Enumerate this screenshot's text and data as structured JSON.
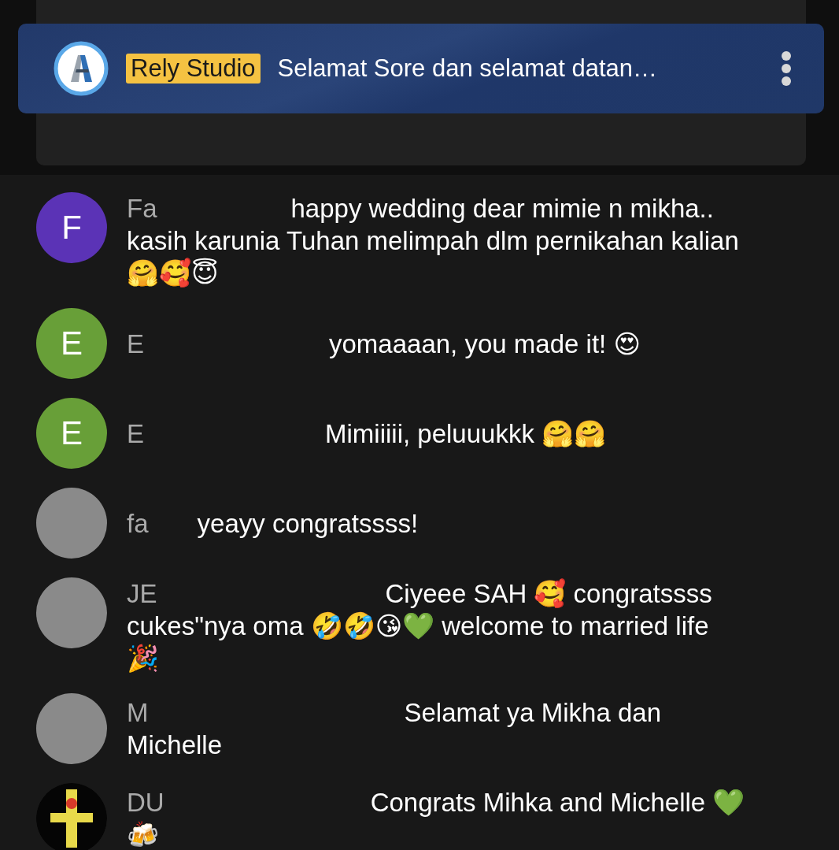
{
  "pinned_message": {
    "author": "Rely Studio",
    "message": "Selamat Sore dan selamat datan…"
  },
  "messages": [
    {
      "avatar": {
        "kind": "letter",
        "letter": "F",
        "color": "#5b33b6"
      },
      "author": "Fa",
      "message_lines": [
        "happy wedding dear mimie n mikha..",
        "kasih karunia Tuhan melimpah dlm pernikahan kalian",
        "🤗🥰😇"
      ]
    },
    {
      "avatar": {
        "kind": "letter",
        "letter": "E",
        "color": "#689f38"
      },
      "author": "E",
      "message_lines": [
        "yomaaaan, you made it! 😍"
      ]
    },
    {
      "avatar": {
        "kind": "letter",
        "letter": "E",
        "color": "#689f38"
      },
      "author": "E",
      "message_lines": [
        "Mimiiiii, peluuukkk 🤗🤗"
      ]
    },
    {
      "avatar": {
        "kind": "photo"
      },
      "author": "fa",
      "message_lines": [
        "yeayy congratssss!"
      ]
    },
    {
      "avatar": {
        "kind": "photo"
      },
      "author": "JE",
      "message_lines": [
        "Ciyeee SAH 🥰 congratssss",
        "cukes\"nya oma 🤣🤣😘💚 welcome to married life",
        "🎉"
      ]
    },
    {
      "avatar": {
        "kind": "photo"
      },
      "author": "M",
      "message_lines": [
        "Selamat ya Mikha dan",
        "Michelle"
      ]
    },
    {
      "avatar": {
        "kind": "logo"
      },
      "author": "DU",
      "message_lines": [
        "Congrats Mihka and Michelle 💚",
        "🍻"
      ]
    }
  ]
}
